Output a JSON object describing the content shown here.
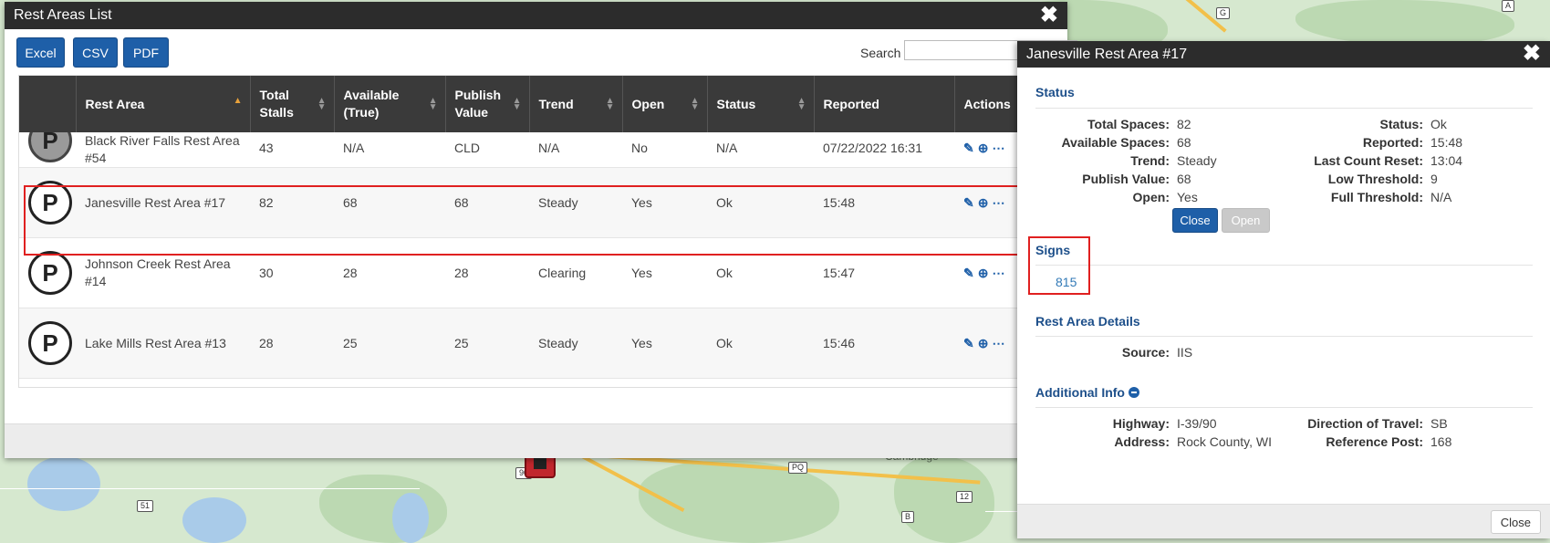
{
  "list_window": {
    "title": "Rest Areas List",
    "buttons": {
      "excel": "Excel",
      "csv": "CSV",
      "pdf": "PDF"
    },
    "search_label": "Search",
    "columns": {
      "rest_area": "Rest Area",
      "total_stalls": "Total Stalls",
      "available": "Available (True)",
      "publish_value": "Publish Value",
      "trend": "Trend",
      "open": "Open",
      "status": "Status",
      "reported": "Reported",
      "actions": "Actions"
    },
    "rows": [
      {
        "name": "Black River Falls Rest Area #54",
        "total": "43",
        "available": "N/A",
        "publish": "CLD",
        "trend": "N/A",
        "open": "No",
        "status": "N/A",
        "reported": "07/22/2022 16:31"
      },
      {
        "name": "Janesville Rest Area #17",
        "total": "82",
        "available": "68",
        "publish": "68",
        "trend": "Steady",
        "open": "Yes",
        "status": "Ok",
        "reported": "15:48"
      },
      {
        "name": "Johnson Creek Rest Area #14",
        "total": "30",
        "available": "28",
        "publish": "28",
        "trend": "Clearing",
        "open": "Yes",
        "status": "Ok",
        "reported": "15:47"
      },
      {
        "name": "Lake Mills Rest Area #13",
        "total": "28",
        "available": "25",
        "publish": "25",
        "trend": "Steady",
        "open": "Yes",
        "status": "Ok",
        "reported": "15:46"
      }
    ],
    "icon_letter": "P"
  },
  "detail": {
    "title": "Janesville Rest Area #17",
    "status_heading": "Status",
    "left_pairs": [
      {
        "k": "Total Spaces:",
        "v": "82"
      },
      {
        "k": "Available Spaces:",
        "v": "68"
      },
      {
        "k": "Trend:",
        "v": "Steady"
      },
      {
        "k": "Publish Value:",
        "v": "68"
      },
      {
        "k": "Open:",
        "v": "Yes"
      }
    ],
    "right_pairs": [
      {
        "k": "Status:",
        "v": "Ok"
      },
      {
        "k": "Reported:",
        "v": "15:48"
      },
      {
        "k": "Last Count Reset:",
        "v": "13:04"
      },
      {
        "k": "Low Threshold:",
        "v": "9"
      },
      {
        "k": "Full Threshold:",
        "v": "N/A"
      }
    ],
    "close_button": "Close",
    "open_button": "Open",
    "signs_heading": "Signs",
    "sign_id": "815",
    "rest_details_heading": "Rest Area Details",
    "source": {
      "k": "Source:",
      "v": "IIS"
    },
    "additional_heading": "Additional Info",
    "highway": {
      "k": "Highway:",
      "v": "I-39/90"
    },
    "address": {
      "k": "Address:",
      "v": "Rock County, WI"
    },
    "direction": {
      "k": "Direction of Travel:",
      "v": "SB"
    },
    "reference": {
      "k": "Reference Post:",
      "v": "168"
    },
    "footer_close": "Close"
  },
  "map": {
    "shields": [
      "G",
      "A",
      "51",
      "90",
      "PQ",
      "12",
      "B"
    ],
    "place_label": "Cambridge"
  }
}
